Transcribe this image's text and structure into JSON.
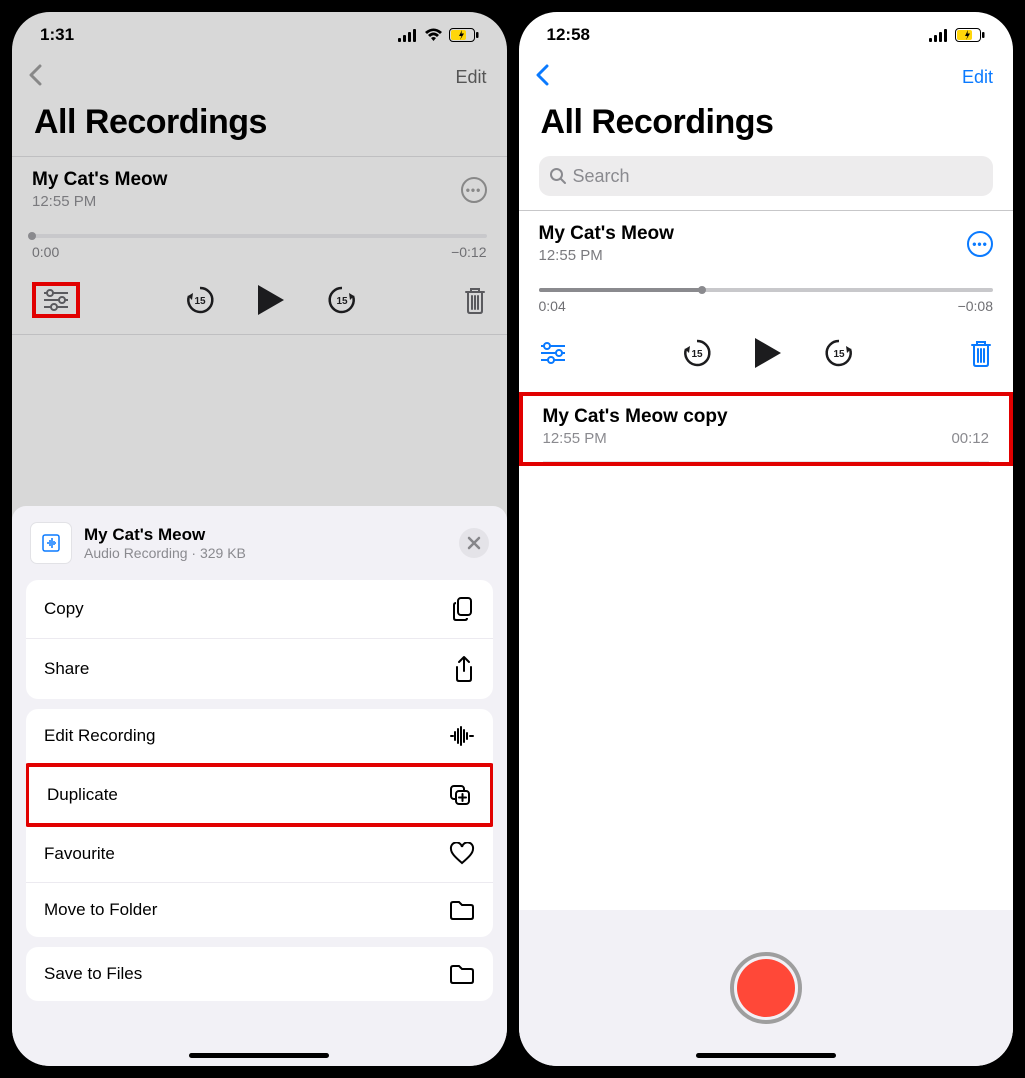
{
  "left": {
    "status_time": "1:31",
    "edit": "Edit",
    "page_title": "All Recordings",
    "recording": {
      "title": "My Cat's Meow",
      "time": "12:55 PM",
      "pos": "0:00",
      "remain": "−0:12",
      "progress_pct": 0
    },
    "sheet": {
      "title": "My Cat's Meow",
      "subtitle": "Audio Recording · 329 KB"
    },
    "actions": {
      "copy": "Copy",
      "share": "Share",
      "edit_rec": "Edit Recording",
      "duplicate": "Duplicate",
      "favourite": "Favourite",
      "move": "Move to Folder",
      "save": "Save to Files"
    }
  },
  "right": {
    "status_time": "12:58",
    "edit": "Edit",
    "page_title": "All Recordings",
    "search_placeholder": "Search",
    "recording": {
      "title": "My Cat's Meow",
      "time": "12:55 PM",
      "pos": "0:04",
      "remain": "−0:08",
      "progress_pct": 36
    },
    "copy_item": {
      "title": "My Cat's Meow copy",
      "time": "12:55 PM",
      "duration": "00:12"
    }
  }
}
